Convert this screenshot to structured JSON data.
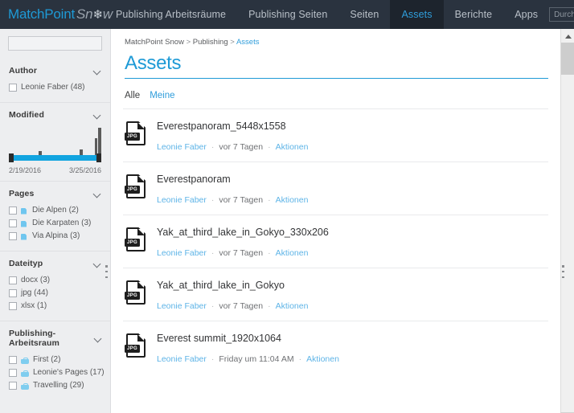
{
  "topnav": {
    "logo": {
      "part1": "MatchPoint",
      "part2": "Sn",
      "flake": "❄",
      "part3": "w"
    },
    "items": [
      {
        "label": "Publishing Arbeitsräume",
        "active": false
      },
      {
        "label": "Publishing Seiten",
        "active": false
      },
      {
        "label": "Seiten",
        "active": false
      },
      {
        "label": "Assets",
        "active": true
      },
      {
        "label": "Berichte",
        "active": false
      },
      {
        "label": "Apps",
        "active": false
      }
    ],
    "search": {
      "value": "",
      "placeholder": "Durchsuche"
    }
  },
  "sidebar": {
    "search": {
      "value": "",
      "placeholder": ""
    },
    "facets": [
      {
        "title": "Author",
        "type": "checkboxes",
        "options": [
          {
            "label": "Leonie Faber (48)",
            "icon": "none",
            "checked": false
          }
        ]
      },
      {
        "title": "Modified",
        "type": "histogram",
        "range_start": "2/19/2016",
        "range_end": "3/25/2016"
      },
      {
        "title": "Pages",
        "type": "checkboxes",
        "options": [
          {
            "label": "Die Alpen (2)",
            "icon": "page",
            "checked": false
          },
          {
            "label": "Die Karpaten (3)",
            "icon": "page",
            "checked": false
          },
          {
            "label": "Via Alpina (3)",
            "icon": "page",
            "checked": false
          }
        ]
      },
      {
        "title": "Dateityp",
        "type": "checkboxes",
        "options": [
          {
            "label": "docx (3)",
            "icon": "none",
            "checked": false
          },
          {
            "label": "jpg (44)",
            "icon": "none",
            "checked": false
          },
          {
            "label": "xlsx (1)",
            "icon": "none",
            "checked": false
          }
        ]
      },
      {
        "title": "Publishing-Arbeitsraum",
        "type": "checkboxes",
        "options": [
          {
            "label": "First (2)",
            "icon": "bag",
            "checked": false
          },
          {
            "label": "Leonie's Pages (17)",
            "icon": "bag",
            "checked": false
          },
          {
            "label": "Travelling (29)",
            "icon": "bag",
            "checked": false
          }
        ]
      }
    ]
  },
  "chart_data": {
    "type": "bar",
    "title": "Modified",
    "xlabel": "",
    "ylabel": "",
    "categories": [
      "2/19/2016",
      "",
      "",
      "",
      "",
      "",
      "",
      "",
      "",
      "",
      "",
      "",
      "",
      "",
      "",
      "",
      "",
      "",
      "",
      "",
      "",
      "",
      "",
      "",
      "3/25/2016"
    ],
    "values": [
      3,
      1,
      1,
      1,
      1,
      1,
      1,
      1,
      7,
      1,
      1,
      1,
      1,
      1,
      1,
      1,
      1,
      1,
      1,
      9,
      1,
      1,
      1,
      24,
      38
    ],
    "ylim": [
      0,
      40
    ],
    "grid": false,
    "legend": null,
    "axis_range_labels": {
      "start": "2/19/2016",
      "end": "3/25/2016"
    }
  },
  "main": {
    "breadcrumb": {
      "root": "MatchPoint Snow",
      "mid": "Publishing",
      "current": "Assets",
      "sep": ">"
    },
    "title": "Assets",
    "tabs": [
      {
        "label": "Alle",
        "active": true
      },
      {
        "label": "Meine",
        "active": false
      }
    ],
    "items": [
      {
        "filetype": "JPG",
        "name": "Everestpanoram_5448x1558",
        "author": "Leonie Faber",
        "modified": "vor 7 Tagen",
        "action": "Aktionen",
        "sep": "·"
      },
      {
        "filetype": "JPG",
        "name": "Everestpanoram",
        "author": "Leonie Faber",
        "modified": "vor 7 Tagen",
        "action": "Aktionen",
        "sep": "·"
      },
      {
        "filetype": "JPG",
        "name": "Yak_at_third_lake_in_Gokyo_330x206",
        "author": "Leonie Faber",
        "modified": "vor 7 Tagen",
        "action": "Aktionen",
        "sep": "·"
      },
      {
        "filetype": "JPG",
        "name": "Yak_at_third_lake_in_Gokyo",
        "author": "Leonie Faber",
        "modified": "vor 7 Tagen",
        "action": "Aktionen",
        "sep": "·"
      },
      {
        "filetype": "JPG",
        "name": "Everest summit_1920x1064",
        "author": "Leonie Faber",
        "modified": "Friday um 11:04 AM",
        "action": "Aktionen",
        "sep": "·"
      }
    ]
  },
  "colors": {
    "nav_bg": "#2a333f",
    "nav_active_bg": "#1d242d",
    "accent": "#1e9ad6",
    "link": "#5eb4e7",
    "sidebar_bg": "#edeef0",
    "slider": "#11a4e0",
    "bar": "#5b5b5b"
  }
}
